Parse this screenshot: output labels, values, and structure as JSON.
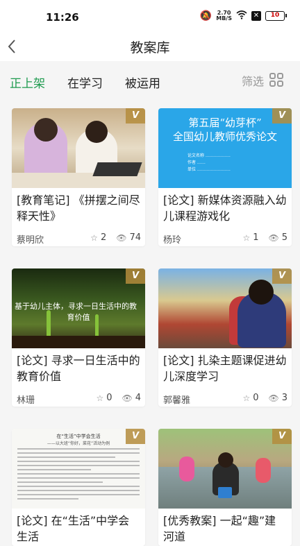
{
  "status_bar": {
    "time": "11:26",
    "speed_value": "2.70",
    "speed_unit": "MB/S",
    "battery": "10"
  },
  "header": {
    "title": "教案库"
  },
  "tabs": [
    {
      "label": "正上架",
      "active": true
    },
    {
      "label": "在学习",
      "active": false
    },
    {
      "label": "被运用",
      "active": false
    }
  ],
  "filter": {
    "label": "筛选"
  },
  "colors": {
    "accent": "#1f9b4f",
    "badge": "#b48c3c"
  },
  "cards": [
    {
      "title": "[教育笔记] 《拼摆之间尽释天性》",
      "author": "蔡明欣",
      "stars": "2",
      "views": "74",
      "badge": "V"
    },
    {
      "title": "[论文] 新媒体资源融入幼儿课程游戏化",
      "author": "杨玲",
      "stars": "1",
      "views": "5",
      "badge": "V",
      "thumb_line1": "第五届“幼芽杯”",
      "thumb_line2": "全国幼儿教师优秀论文"
    },
    {
      "title": "[论文] 寻求一日生活中的教育价值",
      "author": "林珊",
      "stars": "0",
      "views": "4",
      "badge": "V",
      "thumb_line1": "基于幼儿主体，寻求一日生活中的教",
      "thumb_line2": "育价值"
    },
    {
      "title": "[论文] 扎染主题课促进幼儿深度学习",
      "author": "郭馨雅",
      "stars": "0",
      "views": "3",
      "badge": "V"
    },
    {
      "title": "[论文] 在“生活”中学会生活",
      "author": "",
      "stars": "",
      "views": "",
      "badge": "V",
      "thumb_line1": "在“生活”中学会生活",
      "thumb_line2": "——以大班“你好，菜花”活动为例"
    },
    {
      "title": "[优秀教案] 一起“趣”建河道",
      "author": "",
      "stars": "",
      "views": "",
      "badge": "V"
    }
  ]
}
